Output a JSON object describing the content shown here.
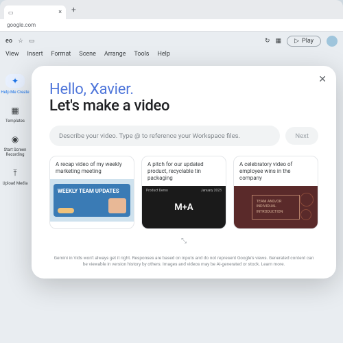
{
  "browser": {
    "tab_close": "×",
    "newtab": "+",
    "address": "google.com"
  },
  "app": {
    "title_suffix": "eo",
    "star": "☆",
    "folder": "▭",
    "history_icon": "↻",
    "grid_icon": "▦",
    "play_label": "Play",
    "menus": [
      "View",
      "Insert",
      "Format",
      "Scene",
      "Arrange",
      "Tools",
      "Help"
    ]
  },
  "rail": {
    "items": [
      {
        "icon": "✦",
        "label": "Help Me Create"
      },
      {
        "icon": "▦",
        "label": "Templates"
      },
      {
        "icon": "◉",
        "label": "Start Screen Recording"
      },
      {
        "icon": "⤒",
        "label": "Upload Media"
      }
    ]
  },
  "modal": {
    "close": "✕",
    "greeting": "Hello, Xavier.",
    "subhead": "Let's make a video",
    "placeholder": "Describe your video. Type @ to reference your Workspace files.",
    "next": "Next",
    "cards": [
      {
        "caption": "A recap video of my weekly marketing meeting",
        "thumb_title": "WEEKLY TEAM UPDATES"
      },
      {
        "caption": "A pitch for our updated product, recyclable tin packaging",
        "thumb_title": "M+A",
        "top_left": "Product Demo",
        "top_right": "January 2023"
      },
      {
        "caption": "A celebratory video of employee wins in the company",
        "thumb_title": "TEAM AND/OR INDIVIDUAL INTRODUCTION"
      }
    ],
    "expand": "⤡",
    "disclaimer": "Gemini in Vids won't always get it right. Responses are based on inputs and do not represent Google's views. Generated content can be viewable in version history by others. Images and videos may be AI-generated or stock. Learn more."
  }
}
